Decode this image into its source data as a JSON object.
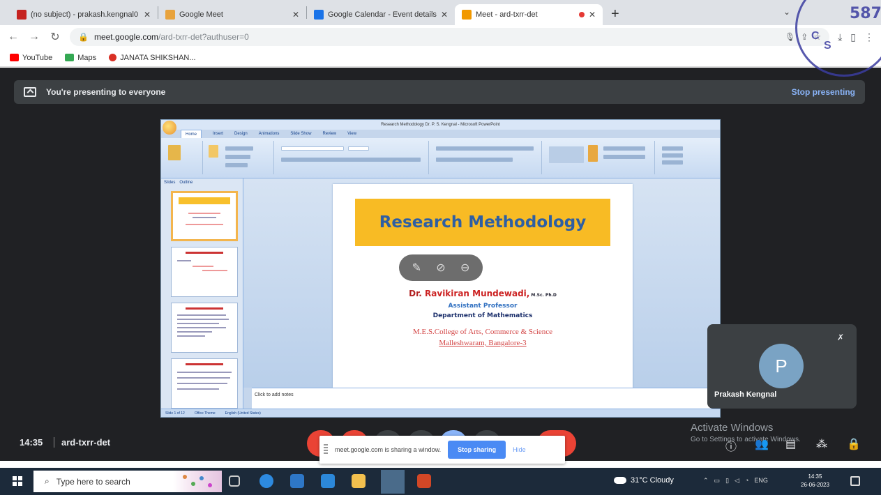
{
  "browser": {
    "tabs": [
      {
        "title": "(no subject) - prakash.kengnal0",
        "favicon_color": "#c5221f"
      },
      {
        "title": "Google Meet",
        "favicon_color": "#e8a33d"
      },
      {
        "title": "Google Calendar - Event details",
        "favicon_color": "#1a73e8"
      },
      {
        "title": "Meet - ard-txrr-det",
        "favicon_color": "#f29900"
      }
    ],
    "url_host": "meet.google.com",
    "url_path": "/ard-txrr-det?authuser=0",
    "bookmarks": [
      {
        "label": "YouTube",
        "color": "#ff0000"
      },
      {
        "label": "Maps",
        "color": "#34a853"
      },
      {
        "label": "JANATA SHIKSHAN...",
        "color": "#d93025"
      }
    ]
  },
  "meet": {
    "banner_text": "You're presenting to everyone",
    "stop_presenting": "Stop presenting",
    "time": "14:35",
    "meeting_code": "ard-txrr-det",
    "participant_initial": "P",
    "participant_name": "Prakash Kengnal",
    "activate_title": "Activate Windows",
    "activate_sub": "Go to Settings to activate Windows."
  },
  "ppt": {
    "window_title": "Research Methodology Dr. P. S. Kengnal - Microsoft PowerPoint",
    "ribbon_tabs": [
      "Home",
      "Insert",
      "Design",
      "Animations",
      "Slide Show",
      "Review",
      "View"
    ],
    "pane_tabs": [
      "Slides",
      "Outline"
    ],
    "slide_title": "Research Methodology",
    "author_prefix": "Dr. ",
    "author_name": "Ravikiran Mundewadi,",
    "author_degree": " M.Sc. Ph.D",
    "designation": "Assistant Professor",
    "department": "Department of Mathematics",
    "college_line1": "M.E.S.College of Arts, Commerce & Science",
    "college_line2": "Malleshwaram, Bangalore-3",
    "notes_placeholder": "Click to add notes",
    "status": [
      "Slide 1 of 12",
      "Office Theme",
      "English (United States)"
    ]
  },
  "share_popup": {
    "text": "meet.google.com is sharing a window.",
    "stop_button": "Stop sharing",
    "hide": "Hide"
  },
  "taskbar": {
    "search_placeholder": "Type here to search",
    "weather": "31°C  Cloudy",
    "lang": "ENG",
    "clock_time": "14:35",
    "clock_date": "26-06-2023"
  },
  "stamp": {
    "number": "587"
  }
}
